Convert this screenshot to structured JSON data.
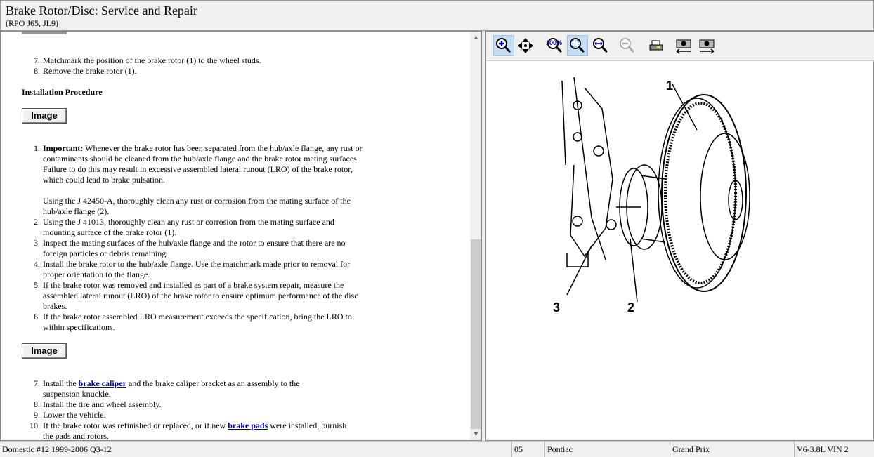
{
  "header": {
    "title": "Brake Rotor/Disc:  Service and Repair",
    "subtitle": "(RPO J65, JL9)"
  },
  "content": {
    "removal_steps": [
      {
        "n": "7.",
        "text": "Matchmark the position of the brake rotor (1) to the wheel studs."
      },
      {
        "n": "8.",
        "text": "Remove the brake rotor (1)."
      }
    ],
    "installation_heading": "Installation Procedure",
    "image_button": "Image",
    "step1": {
      "n": "1.",
      "important": "Important:",
      "text": "  Whenever the brake rotor has been separated from the hub/axle flange, any rust or contaminants should be cleaned from the hub/axle flange and the brake rotor mating surfaces. Failure to do this may result in excessive assembled lateral runout (LRO) of the brake rotor, which could lead to brake pulsation.",
      "text2": "Using the J 42450-A, thoroughly clean any rust or corrosion from the mating surface of the hub/axle flange (2)."
    },
    "steps": [
      {
        "n": "2.",
        "text": "Using the J 41013, thoroughly clean any rust or corrosion from the mating surface and mounting surface of the brake rotor (1)."
      },
      {
        "n": "3.",
        "text": "Inspect the mating surfaces of the hub/axle flange and the rotor to ensure that there are no foreign particles or debris remaining."
      },
      {
        "n": "4.",
        "text": "Install the brake rotor to the hub/axle flange. Use the matchmark made prior to removal for proper orientation to the flange."
      },
      {
        "n": "5.",
        "text": "If the brake rotor was removed and installed as part of a brake system repair, measure the assembled lateral runout (LRO) of the brake rotor to ensure optimum performance of the disc brakes."
      },
      {
        "n": "6.",
        "text": "If the brake rotor assembled LRO measurement exceeds the specification, bring the LRO to within specifications."
      }
    ],
    "step7": {
      "n": "7.",
      "pre": "Install the ",
      "link": "brake caliper",
      "post": " and the brake caliper bracket as an assembly to the suspension knuckle."
    },
    "step8": {
      "n": "8.",
      "text": "Install the tire and wheel assembly."
    },
    "step9": {
      "n": "9.",
      "text": "Lower the vehicle."
    },
    "step10": {
      "n": "10.",
      "pre": "If the brake rotor was refinished or replaced, or if new ",
      "link": "brake pads",
      "post": " were installed, burnish the pads and rotors."
    }
  },
  "toolbar": {
    "zoom_percent_label": "100%"
  },
  "diagram": {
    "labels": [
      "1",
      "2",
      "3"
    ]
  },
  "status": {
    "edition": "Domestic #12 1999-2006 Q3-12",
    "year": "05",
    "make": "Pontiac",
    "model": "Grand Prix",
    "engine": "V6-3.8L VIN 2"
  }
}
